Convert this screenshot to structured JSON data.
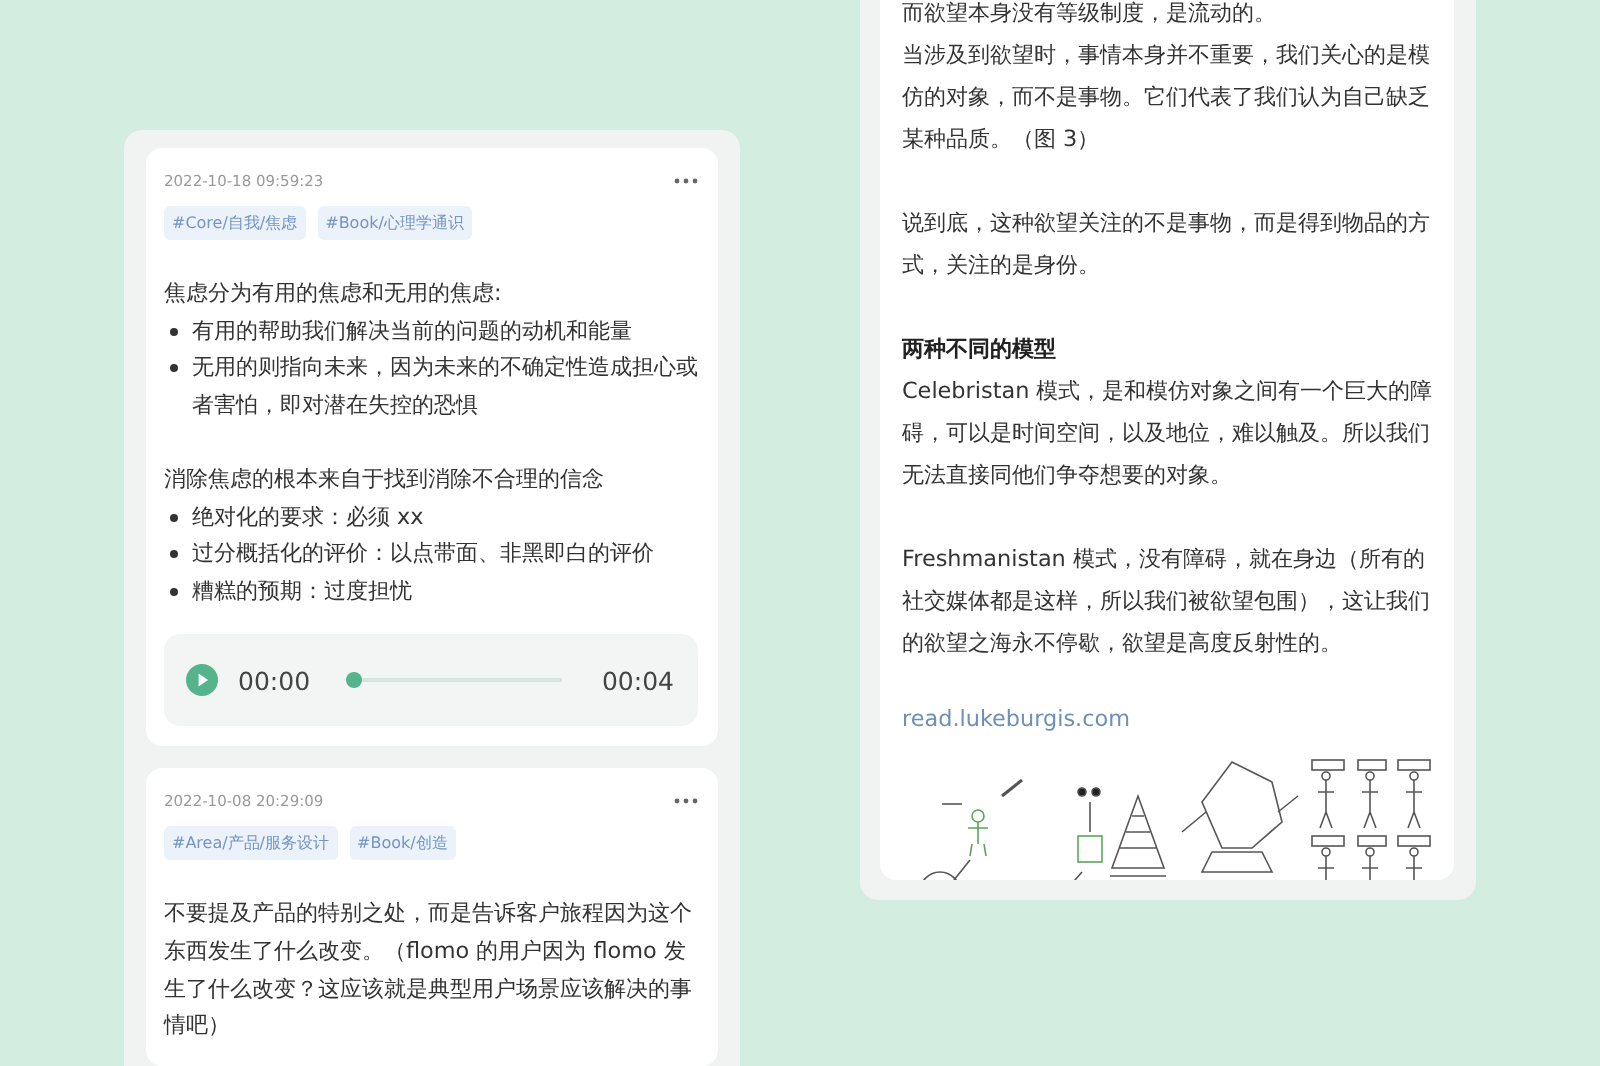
{
  "memo_column": {
    "memos": [
      {
        "timestamp": "2022-10-18 09:59:23",
        "tags": [
          "#Core/自我/焦虑",
          "#Book/心理学通识"
        ],
        "sections": [
          [
            {
              "kind": "text",
              "text": "焦虑分为有用的焦虑和无用的焦虑:"
            },
            {
              "kind": "bullet",
              "text": "有用的帮助我们解决当前的问题的动机和能量"
            },
            {
              "kind": "bullet",
              "text": "无用的则指向未来，因为未来的不确定性造成担心或者害怕，即对潜在失控的恐惧"
            }
          ],
          [
            {
              "kind": "text",
              "text": "消除焦虑的根本来自于找到消除不合理的信念"
            },
            {
              "kind": "bullet",
              "text": "绝对化的要求：必须 xx"
            },
            {
              "kind": "bullet",
              "text": "过分概括化的评价：以点带面、非黑即白的评价"
            },
            {
              "kind": "bullet",
              "text": "糟糕的预期：过度担忧"
            }
          ]
        ],
        "audio": {
          "current": "00:00",
          "duration": "00:04",
          "level": 0
        }
      },
      {
        "timestamp": "2022-10-08 20:29:09",
        "tags": [
          "#Area/产品/服务设计",
          "#Book/创造"
        ],
        "sections": [
          [
            {
              "kind": "text",
              "text": "不要提及产品的特别之处，而是告诉客户旅程因为这个东西发生了什么改变。（flomo 的用户因为 flomo 发生了什么改变？这应该就是典型用户场景应该解决的事情吧）"
            }
          ]
        ]
      }
    ]
  },
  "article_card": {
    "sections": [
      [
        {
          "kind": "text",
          "text": "而欲望本身没有等级制度，是流动的。"
        },
        {
          "kind": "text",
          "text": "当涉及到欲望时，事情本身并不重要，我们关心的是模仿的对象，而不是事物。它们代表了我们认为自己缺乏某种品质。（图 3）"
        }
      ],
      [
        {
          "kind": "text",
          "text": "说到底，这种欲望关注的不是事物，而是得到物品的方式，关注的是身份。"
        }
      ],
      [
        {
          "kind": "heading",
          "text": "两种不同的模型"
        },
        {
          "kind": "text",
          "text": "Celebristan 模式，是和模仿对象之间有一个巨大的障碍，可以是时间空间，以及地位，难以触及。所以我们无法直接同他们争夺想要的对象。"
        }
      ],
      [
        {
          "kind": "text",
          "text": "Freshmanistan 模式，没有障碍，就在身边（所有的社交媒体都是这样，所以我们被欲望包围），这让我们的欲望之海永不停歇，欲望是高度反射性的。"
        }
      ],
      [
        {
          "kind": "link",
          "text": "read.lukeburgis.com"
        }
      ]
    ]
  }
}
